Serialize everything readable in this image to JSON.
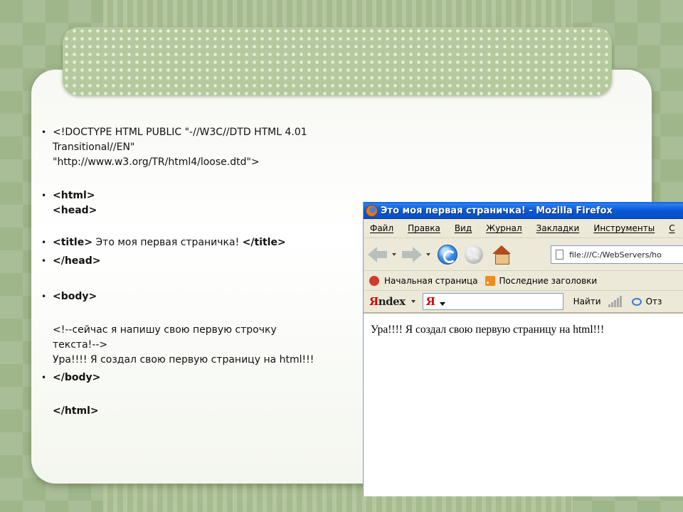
{
  "slide": {
    "code_items": [
      {
        "lines": [
          "<!DOCTYPE HTML PUBLIC \"-//W3C//DTD HTML 4.01",
          "Transitional//EN\"",
          "\"http://www.w3.org/TR/html4/loose.dtd\">"
        ]
      },
      {
        "lines": [
          "<html>",
          "<head>"
        ]
      },
      {
        "tag_open": "<title>",
        "text": " Это моя первая страничка! ",
        "tag_close": "</title>"
      },
      {
        "lines": [
          "</head>"
        ]
      },
      {
        "lines": [
          "<body>"
        ],
        "comment": [
          "<!--сейчас я напишу свою первую строчку",
          "текста!-->"
        ],
        "text": "Ура!!!! Я создал свою первую страницу на html!!!"
      },
      {
        "lines": [
          "</body>"
        ],
        "after": "</html>"
      }
    ]
  },
  "browser": {
    "window_title": "Это моя первая страничка! - Mozilla Firefox",
    "menu": [
      "Файл",
      "Правка",
      "Вид",
      "Журнал",
      "Закладки",
      "Инструменты",
      "С"
    ],
    "url": "file:///C:/WebServers/ho",
    "bookmarks": [
      "Начальная страница",
      "Последние заголовки"
    ],
    "yandex": {
      "logo_prefix": "Я",
      "logo_suffix": "ndex",
      "input_value": "Я",
      "find_label": "Найти",
      "last_label": "Отз"
    },
    "page_text": "Ура!!!! Я создал свою первую страницу на html!!!"
  }
}
